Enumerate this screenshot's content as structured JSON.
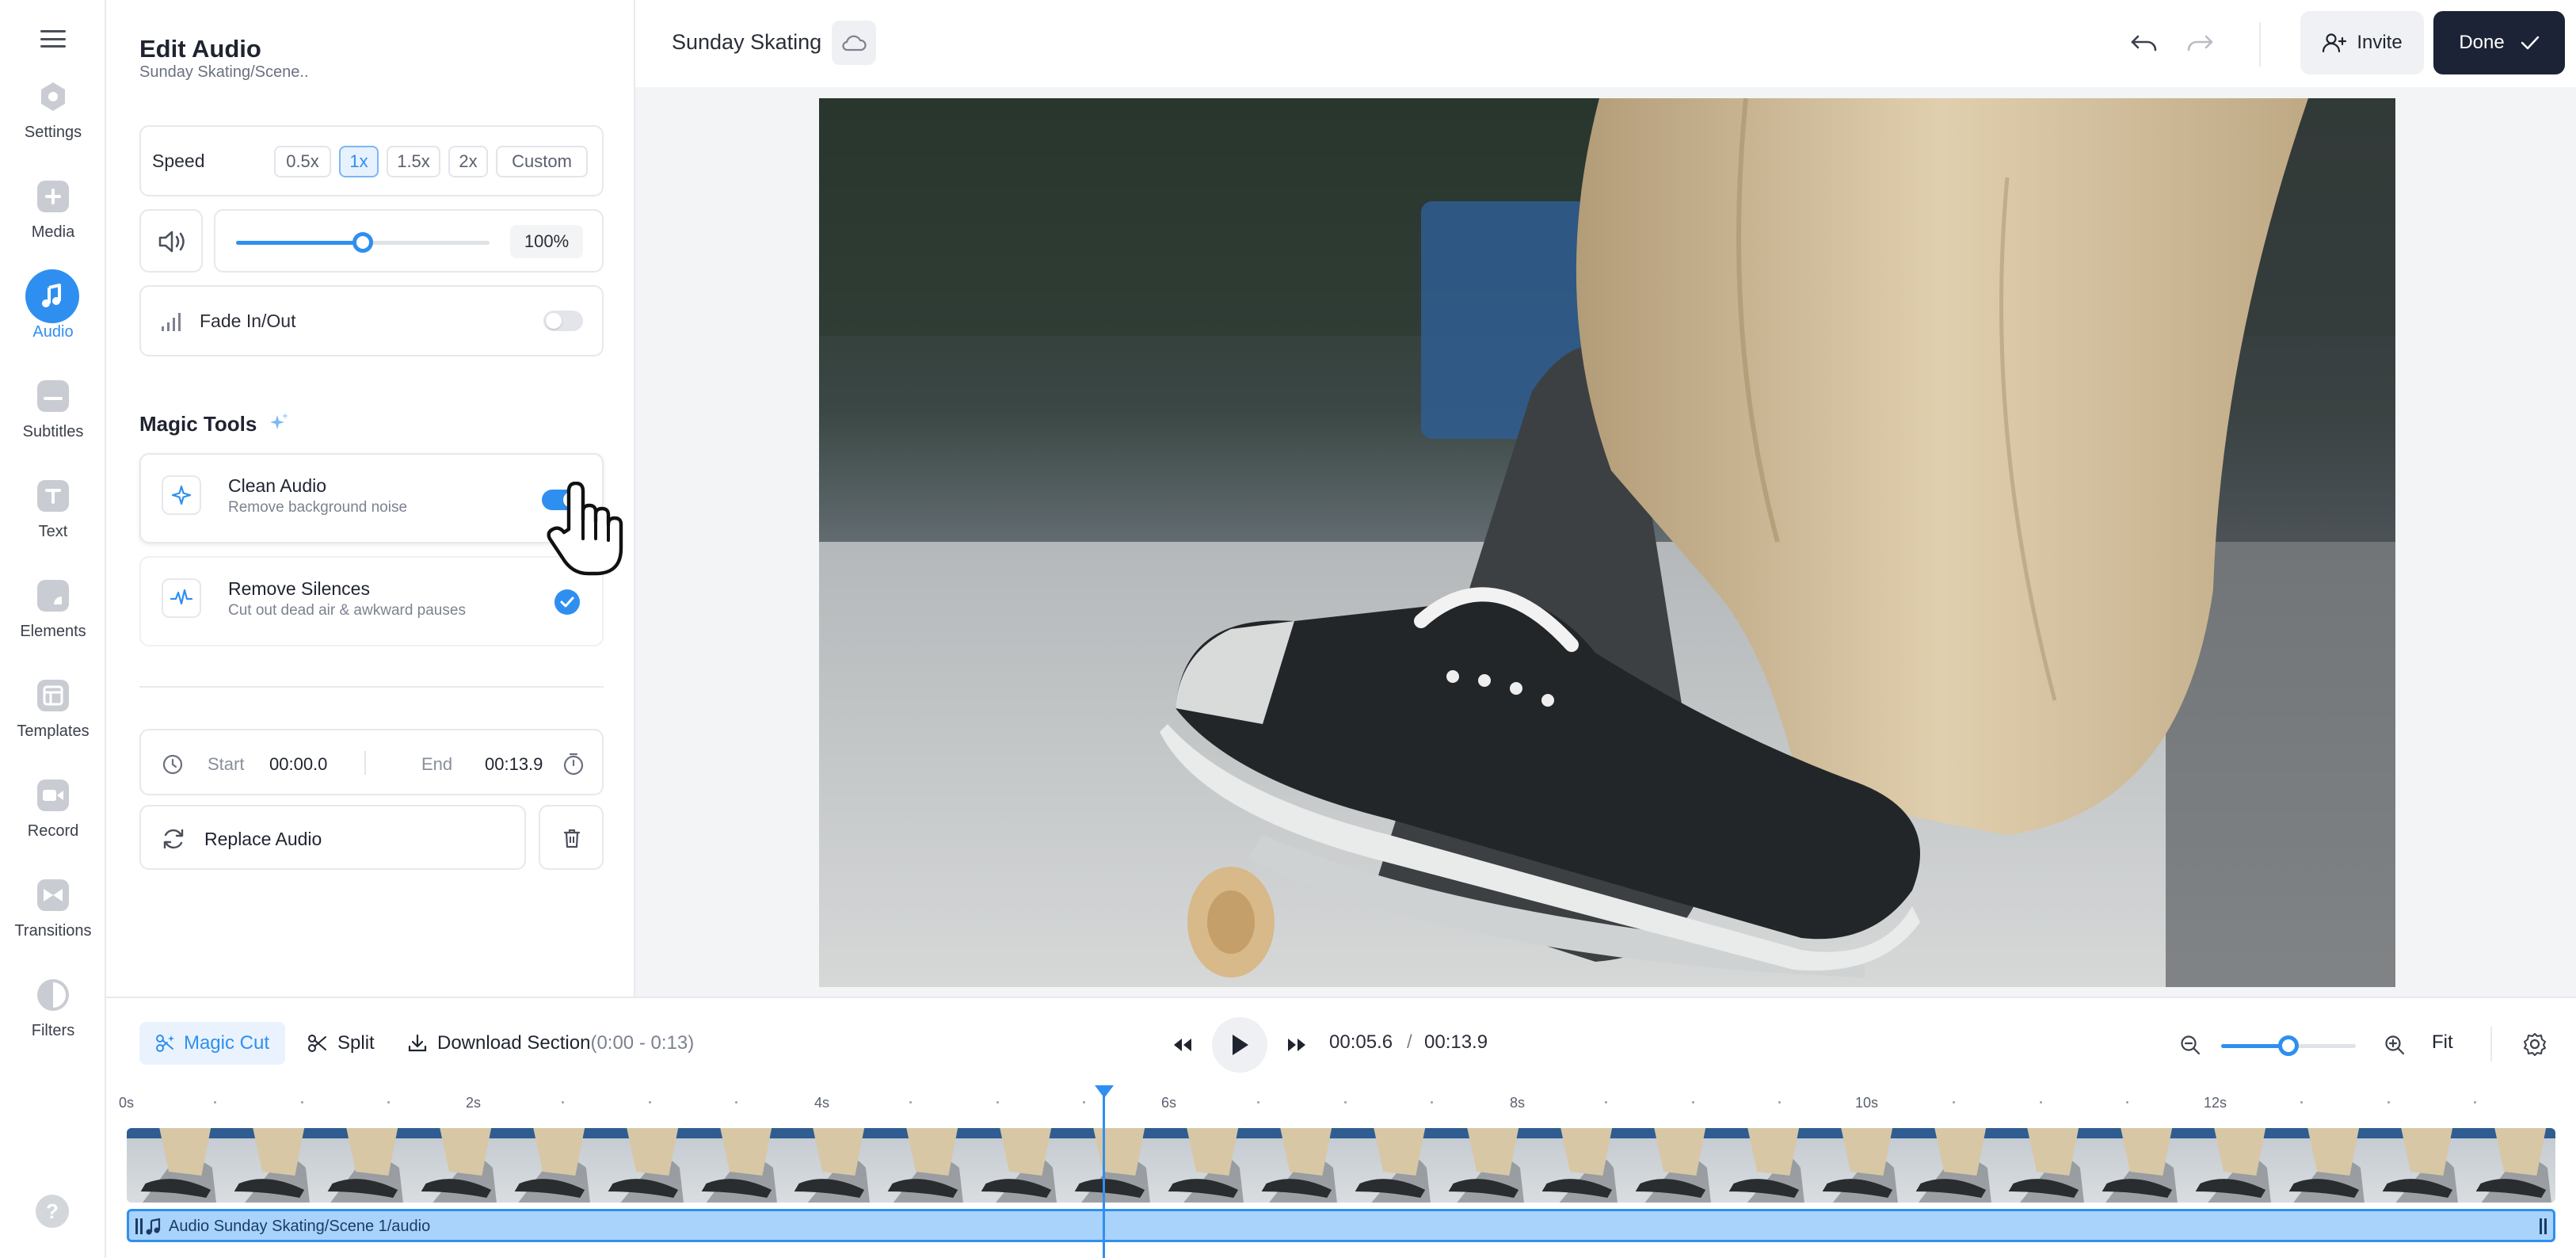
{
  "app": {
    "project_title": "Sunday Skating"
  },
  "rail": {
    "items": [
      {
        "label": "Settings",
        "icon": "settings-icon"
      },
      {
        "label": "Media",
        "icon": "plus-icon"
      },
      {
        "label": "Audio",
        "icon": "music-note-icon",
        "active": true
      },
      {
        "label": "Subtitles",
        "icon": "subtitles-icon"
      },
      {
        "label": "Text",
        "icon": "text-icon"
      },
      {
        "label": "Elements",
        "icon": "elements-icon"
      },
      {
        "label": "Templates",
        "icon": "templates-icon"
      },
      {
        "label": "Record",
        "icon": "record-icon"
      },
      {
        "label": "Transitions",
        "icon": "transitions-icon"
      },
      {
        "label": "Filters",
        "icon": "filters-icon"
      }
    ],
    "help_label": "?"
  },
  "panel": {
    "title": "Edit Audio",
    "subtitle": "Sunday Skating/Scene..",
    "speed": {
      "label": "Speed",
      "options": [
        "0.5x",
        "1x",
        "1.5x",
        "2x",
        "Custom"
      ],
      "selected": "1x"
    },
    "volume": {
      "value_label": "100%",
      "level": 0.5
    },
    "fade": {
      "label": "Fade In/Out",
      "enabled": false
    },
    "magic_tools": {
      "title": "Magic Tools",
      "tools": [
        {
          "name": "Clean Audio",
          "description": "Remove background noise",
          "enabled": true
        },
        {
          "name": "Remove Silences",
          "description": "Cut out dead air & awkward pauses",
          "checked": true
        }
      ]
    },
    "trim": {
      "start_label": "Start",
      "start_value": "00:00.0",
      "end_label": "End",
      "end_value": "00:13.9"
    },
    "replace_label": "Replace Audio"
  },
  "topbar": {
    "invite_label": "Invite",
    "done_label": "Done"
  },
  "bottom": {
    "magic_cut_label": "Magic Cut",
    "split_label": "Split",
    "download_label": "Download Section",
    "download_range": "(0:00 - 0:13)",
    "current_time": "00:05.6",
    "separator": "/",
    "total_time": "00:13.9",
    "fit_label": "Fit",
    "zoom_level": 0.5,
    "timeline_ticks": [
      "0s",
      "2s",
      "4s",
      "6s",
      "8s",
      "10s",
      "12s"
    ],
    "playhead_seconds": 5.6,
    "audio_track_label": "Audio Sunday Skating/Scene 1/audio"
  },
  "colors": {
    "accent": "#2f8ff0",
    "done_button": "#1c2336"
  }
}
